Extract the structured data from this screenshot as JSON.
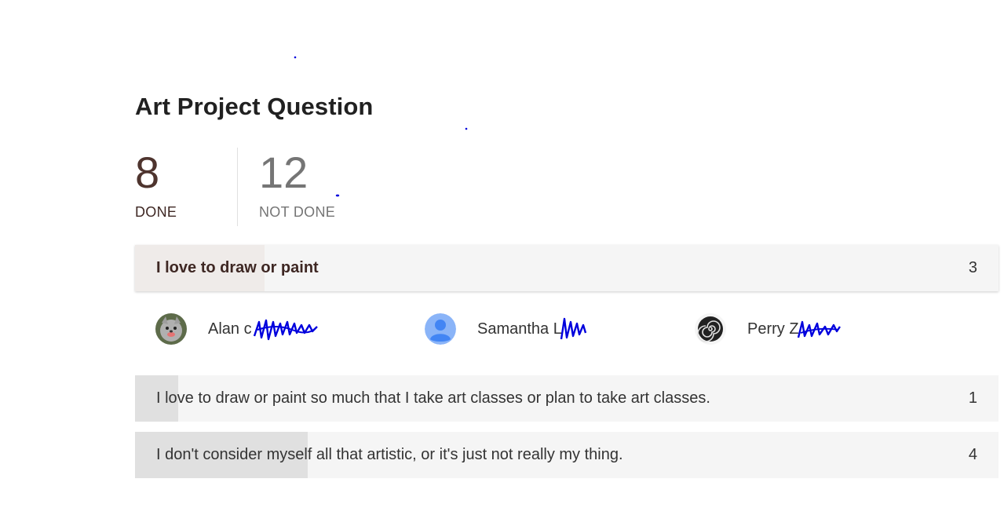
{
  "question": {
    "title": "Art Project Question"
  },
  "stats": {
    "done_count": "8",
    "done_label": "DONE",
    "not_done_count": "12",
    "not_done_label": "NOT DONE"
  },
  "answers": [
    {
      "text": "I love to draw or paint",
      "count": "3",
      "fill_fraction": 0.15,
      "selected": true
    },
    {
      "text": "I love to draw or paint so much that I take art classes or plan to take art classes.",
      "count": "1",
      "fill_fraction": 0.05,
      "selected": false
    },
    {
      "text": "I don't consider myself all that artistic, or it's just not really my thing.",
      "count": "4",
      "fill_fraction": 0.2,
      "selected": false
    }
  ],
  "students": [
    {
      "name": "Alan c",
      "avatar": "wolf-photo-avatar"
    },
    {
      "name": "Samantha L",
      "avatar": "default-person-avatar"
    },
    {
      "name": "Perry Z",
      "avatar": "spiral-shell-avatar"
    }
  ],
  "colors": {
    "done": "#4e342e",
    "not_done": "#757575",
    "row_bg": "#f5f5f5",
    "selected_fill": "#efebe9",
    "row_fill": "#e0e0e0",
    "default_avatar": "#4285f4",
    "redaction_ink": "#0000dd"
  }
}
